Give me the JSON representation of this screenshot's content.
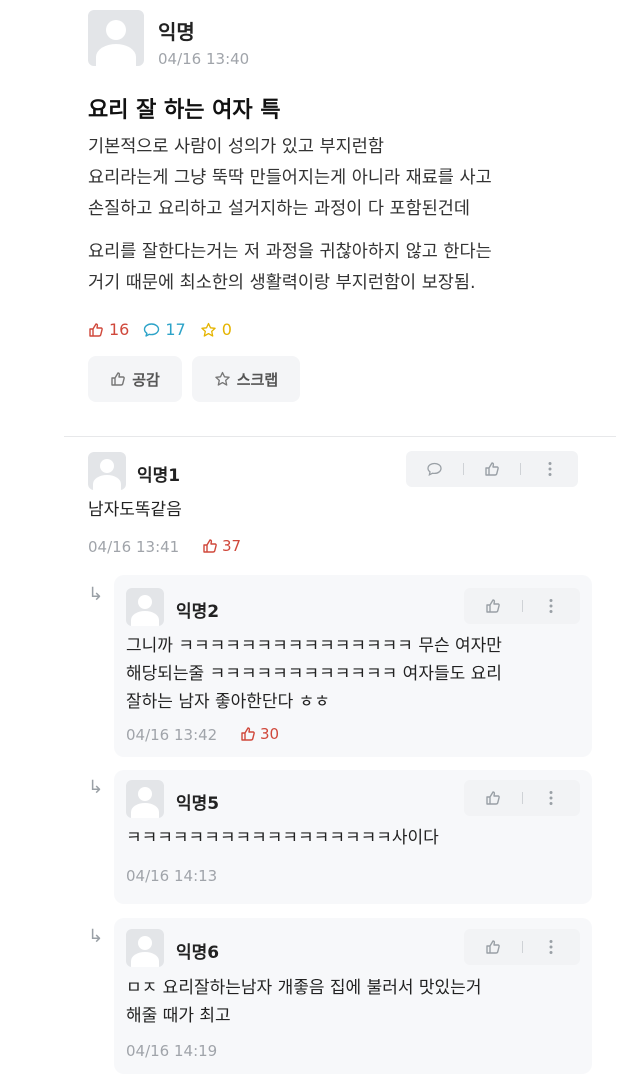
{
  "post": {
    "author": "익명",
    "date": "04/16 13:40",
    "title": "요리 잘 하는 여자 특",
    "body_p1": "기본적으로 사람이 성의가 있고 부지런함\n요리라는게 그냥 뚝딱 만들어지는게 아니라 재료를 사고\n손질하고 요리하고 설거지하는 과정이 다 포함된건데",
    "body_p2": "요리를 잘한다는거는 저 과정을 귀찮아하지 않고 한다는\n거기 때문에 최소한의 생활력이랑 부지런함이 보장됨.",
    "likes": "16",
    "comments": "17",
    "scraps": "0",
    "like_button": "공감",
    "scrap_button": "스크랩"
  },
  "comments": [
    {
      "author": "익명1",
      "text": "남자도똑같음",
      "date": "04/16 13:41",
      "likes": "37"
    }
  ],
  "replies": [
    {
      "author": "익명2",
      "text": "그니까 ㅋㅋㅋㅋㅋㅋㅋㅋㅋㅋㅋㅋㅋㅋㅋ 무슨 여자만\n해당되는줄 ㅋㅋㅋㅋㅋㅋㅋㅋㅋㅋㅋㅋ 여자들도 요리\n잘하는 남자 좋아한단다 ㅎㅎ",
      "date": "04/16 13:42",
      "likes": "30"
    },
    {
      "author": "익명5",
      "text": "ㅋㅋㅋㅋㅋㅋㅋㅋㅋㅋㅋㅋㅋㅋㅋㅋㅋ사이다",
      "date": "04/16 14:13",
      "likes": ""
    },
    {
      "author": "익명6",
      "text": "ㅁㅈ 요리잘하는남자 개좋음 집에 불러서 맛있는거\n해줄 때가 최고",
      "date": "04/16 14:19",
      "likes": ""
    }
  ],
  "colors": {
    "like": "#d0483b",
    "comment": "#2da3c8",
    "scrap": "#e5b400"
  },
  "icons": [
    "avatar-icon",
    "thumbs-up-icon",
    "speech-bubble-icon",
    "star-icon",
    "more-icon",
    "reply-arrow-icon"
  ]
}
